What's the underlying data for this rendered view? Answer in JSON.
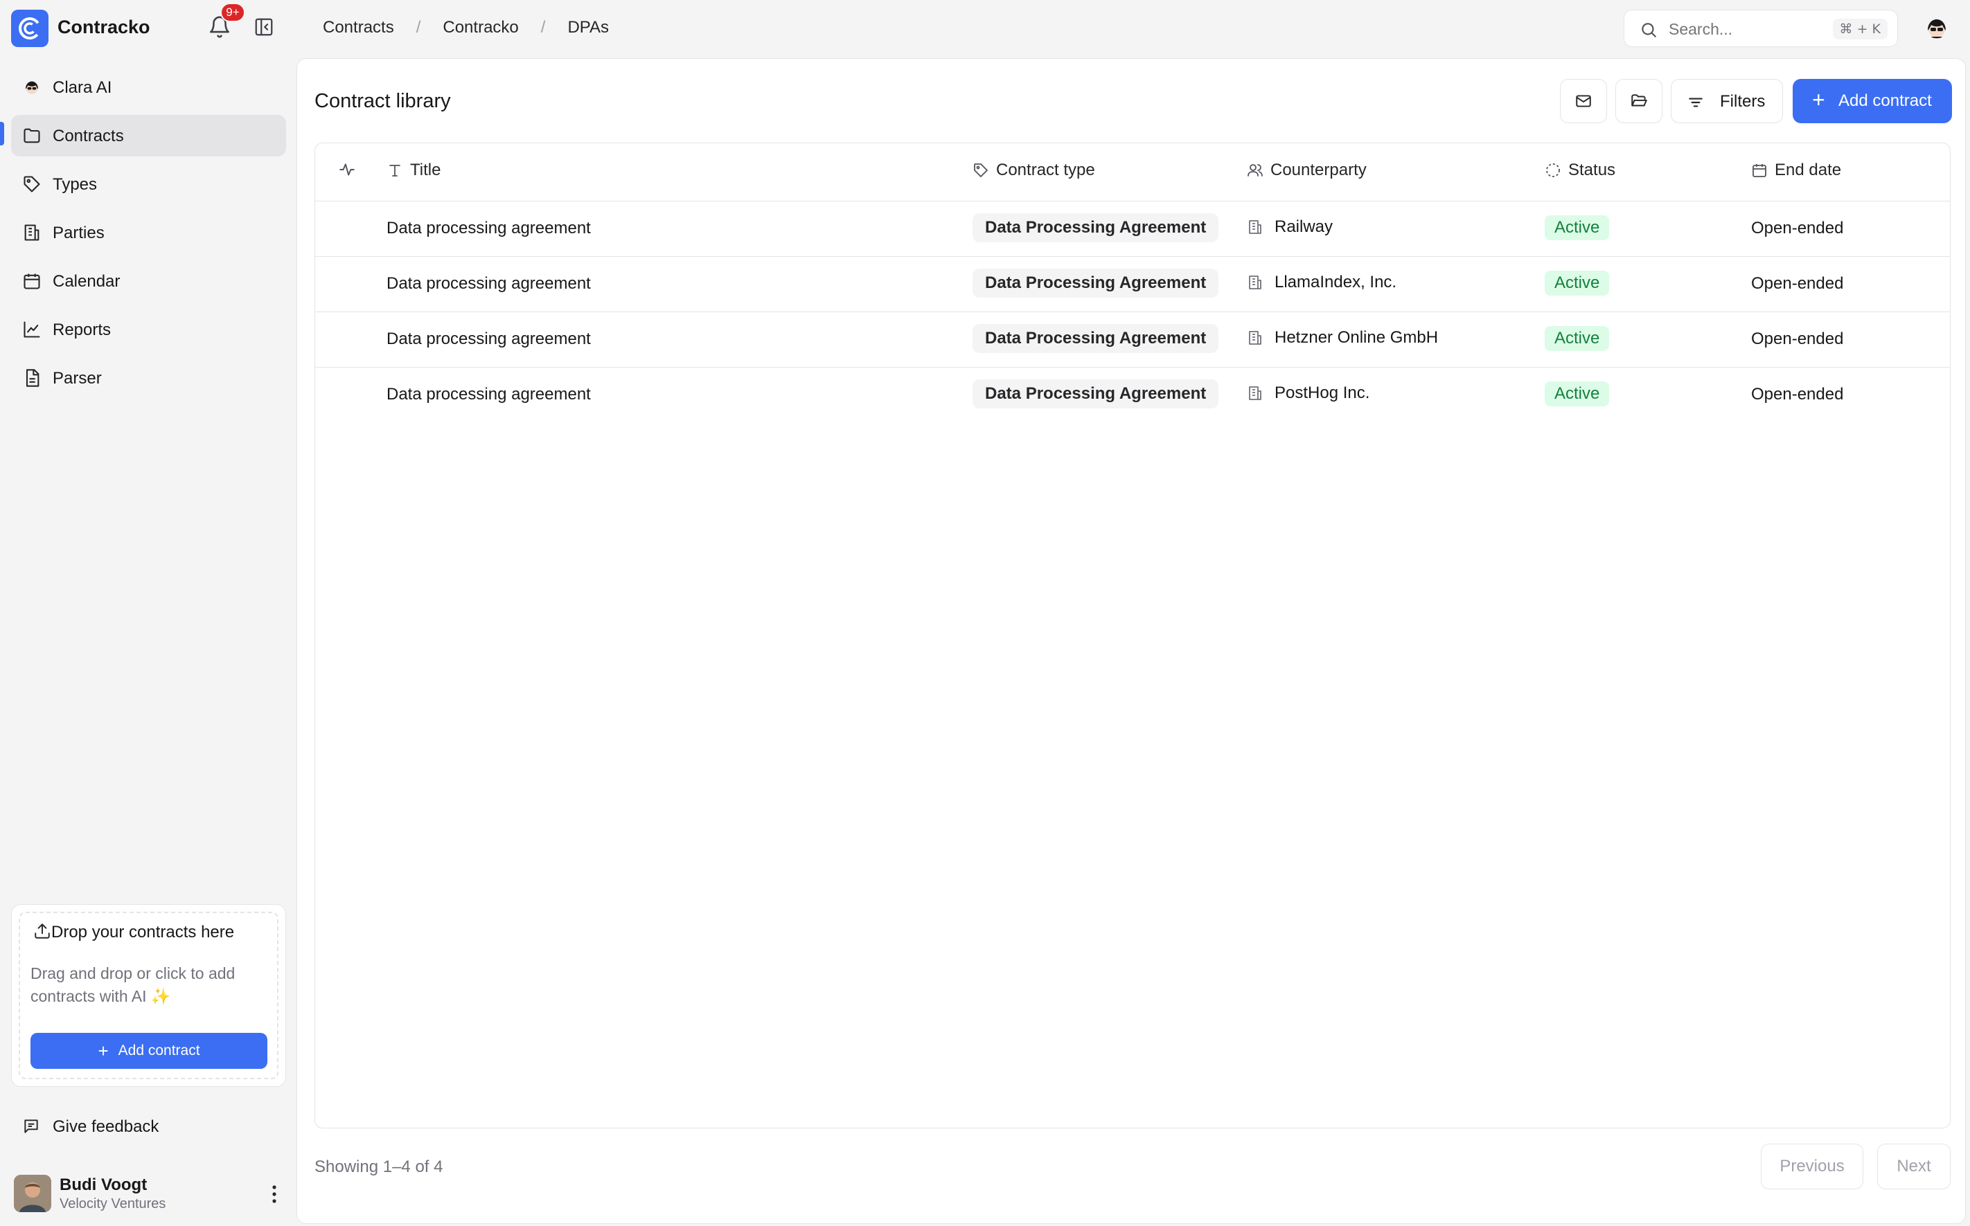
{
  "app": {
    "name": "Contracko",
    "notification_badge": "9+"
  },
  "breadcrumb": {
    "items": [
      "Contracts",
      "Contracko",
      "DPAs"
    ],
    "separator": "/"
  },
  "search": {
    "placeholder": "Search...",
    "shortcut": "⌘ + K"
  },
  "sidebar": {
    "items": [
      {
        "label": "Clara AI",
        "icon": "assistant-avatar-icon"
      },
      {
        "label": "Contracts",
        "icon": "folder-icon",
        "active": true
      },
      {
        "label": "Types",
        "icon": "tag-icon"
      },
      {
        "label": "Parties",
        "icon": "building-icon"
      },
      {
        "label": "Calendar",
        "icon": "calendar-icon"
      },
      {
        "label": "Reports",
        "icon": "line-chart-icon"
      },
      {
        "label": "Parser",
        "icon": "document-icon"
      }
    ],
    "drop_zone": {
      "title": "Drop your contracts here",
      "description": "Drag and drop or click to add contracts with AI ✨",
      "button": "Add contract"
    },
    "feedback": "Give feedback",
    "user": {
      "name": "Budi Voogt",
      "org": "Velocity Ventures"
    }
  },
  "main": {
    "title": "Contract library",
    "filters_label": "Filters",
    "add_contract_label": "Add contract",
    "columns": {
      "title": "Title",
      "contract_type": "Contract type",
      "counterparty": "Counterparty",
      "status": "Status",
      "end_date": "End date"
    },
    "rows": [
      {
        "title": "Data processing agreement",
        "type": "Data Processing Agreement",
        "counterparty": "Railway",
        "status": "Active",
        "end_date": "Open-ended"
      },
      {
        "title": "Data processing agreement",
        "type": "Data Processing Agreement",
        "counterparty": "LlamaIndex, Inc.",
        "status": "Active",
        "end_date": "Open-ended"
      },
      {
        "title": "Data processing agreement",
        "type": "Data Processing Agreement",
        "counterparty": "Hetzner Online GmbH",
        "status": "Active",
        "end_date": "Open-ended"
      },
      {
        "title": "Data processing agreement",
        "type": "Data Processing Agreement",
        "counterparty": "PostHog Inc.",
        "status": "Active",
        "end_date": "Open-ended"
      }
    ],
    "pagination": {
      "showing": "Showing 1–4 of 4",
      "previous": "Previous",
      "next": "Next"
    }
  },
  "colors": {
    "accent": "#3b6ef2",
    "status_active_bg": "#dcfce7",
    "status_active_text": "#15803d",
    "badge": "#dc2626"
  }
}
